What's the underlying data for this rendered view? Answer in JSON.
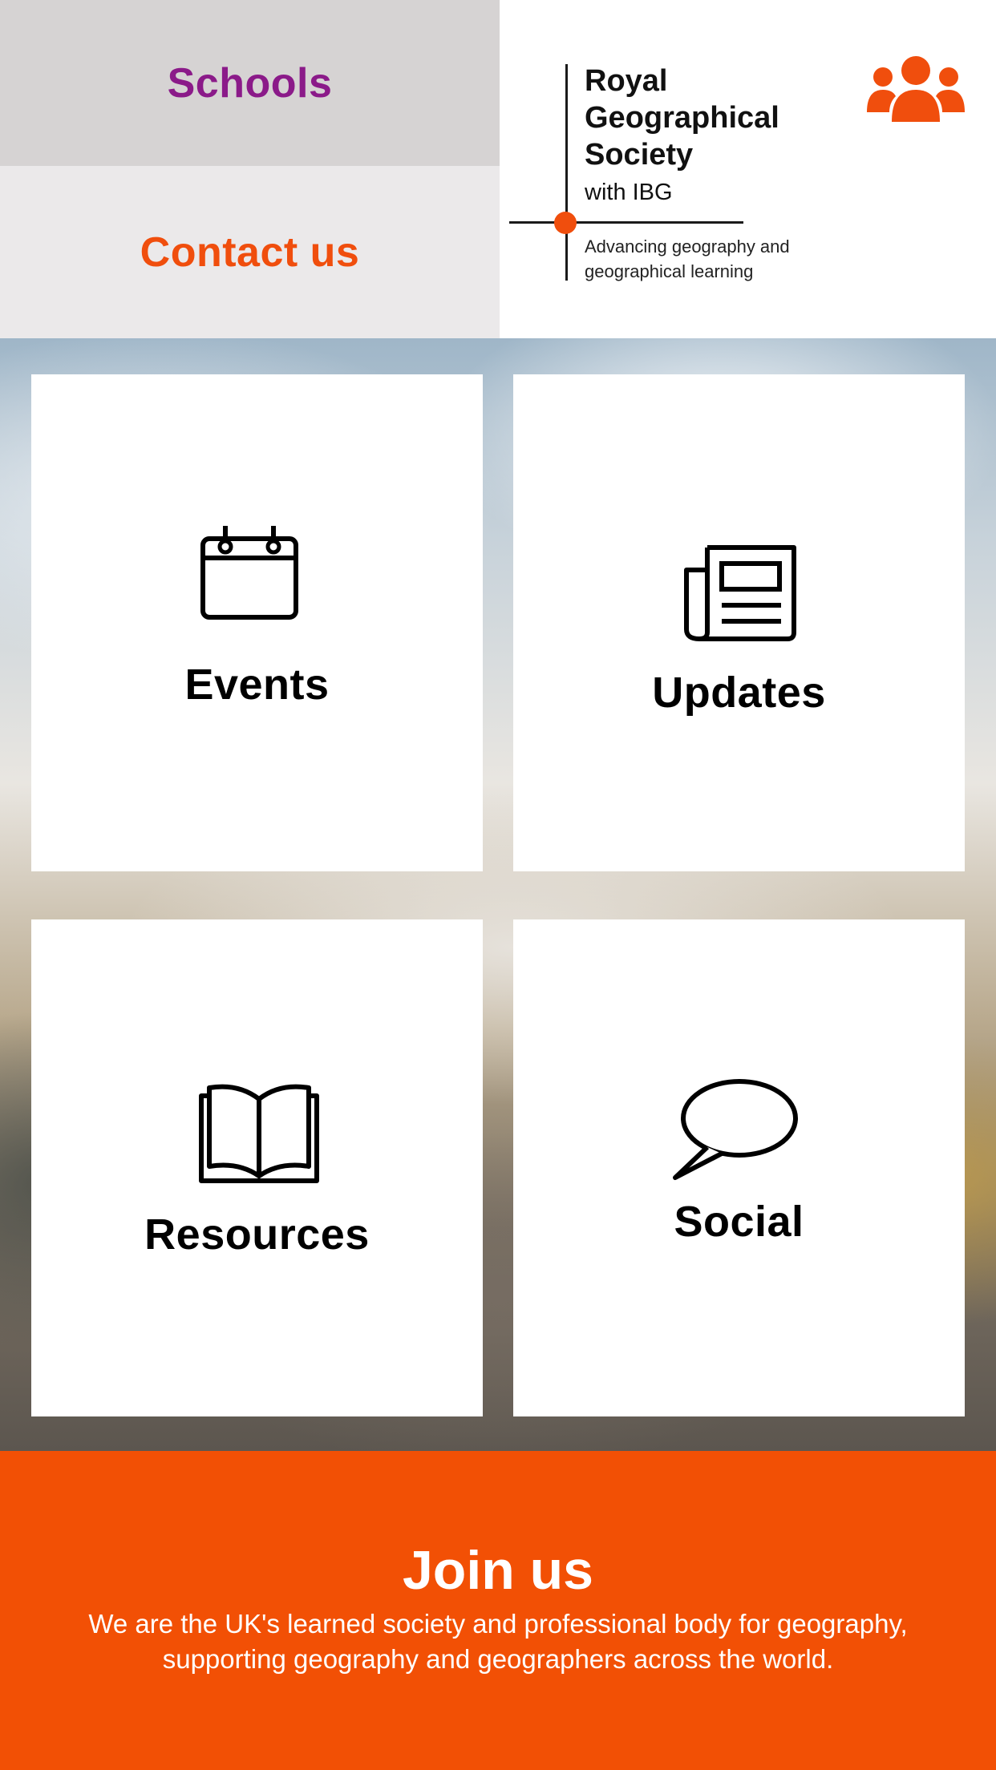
{
  "nav": {
    "schools_label": "Schools",
    "contact_label": "Contact us"
  },
  "logo": {
    "title": "Royal Geographical Society",
    "with_line": "with IBG",
    "tagline": "Advancing geography and geographical learning",
    "accent_color": "#f04e0d"
  },
  "members_icon": "users-group-icon",
  "tiles": [
    {
      "label": "Events",
      "icon": "calendar-icon"
    },
    {
      "label": "Updates",
      "icon": "newspaper-icon"
    },
    {
      "label": "Resources",
      "icon": "open-book-icon"
    },
    {
      "label": "Social",
      "icon": "speech-bubble-icon"
    }
  ],
  "join": {
    "title": "Join us",
    "text": "We are the UK's learned society and professional body for geography, supporting geography and geographers across the world.",
    "color": "#f25005"
  }
}
